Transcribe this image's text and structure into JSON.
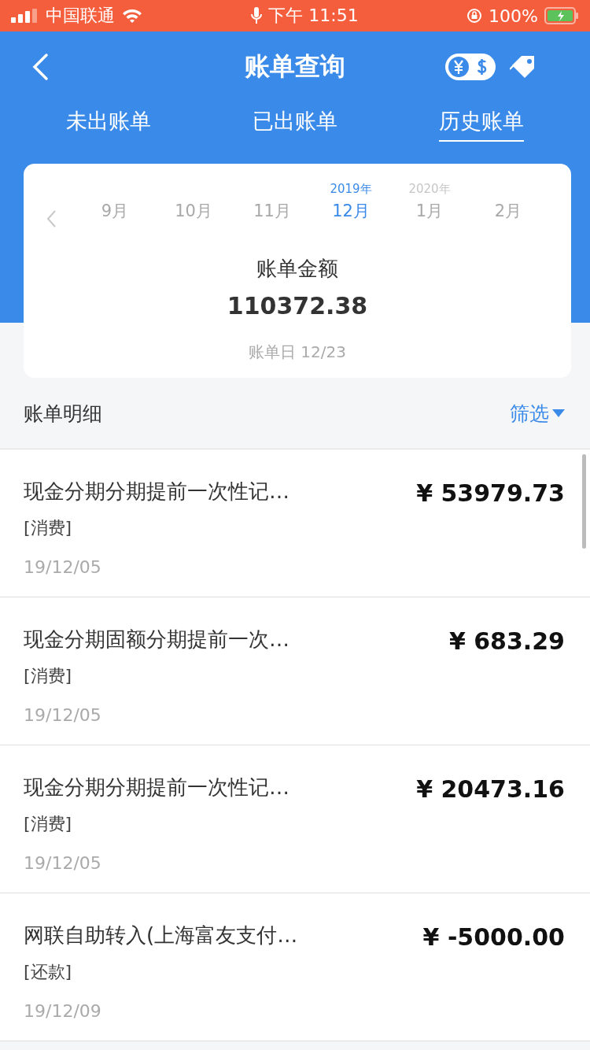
{
  "status_bar": {
    "carrier": "中国联通",
    "time": "下午 11:51",
    "battery": "100%"
  },
  "nav": {
    "title": "账单查询"
  },
  "tabs": [
    {
      "label": "未出账单",
      "selected": false
    },
    {
      "label": "已出账单",
      "selected": false
    },
    {
      "label": "历史账单",
      "selected": true
    }
  ],
  "months": [
    {
      "month": "9月",
      "selected": false
    },
    {
      "month": "10月",
      "selected": false
    },
    {
      "month": "11月",
      "selected": false
    },
    {
      "year": "2019年",
      "month": "12月",
      "selected": true
    },
    {
      "year": "2020年",
      "month": "1月",
      "selected": false
    },
    {
      "month": "2月",
      "selected": false
    }
  ],
  "summary": {
    "label": "账单金额",
    "amount": "110372.38",
    "bill_date": "账单日 12/23"
  },
  "details": {
    "title": "账单明细",
    "filter": "筛选"
  },
  "transactions": [
    {
      "title": "现金分期分期提前一次性记…",
      "category": "[消费]",
      "date": "19/12/05",
      "amount": "¥ 53979.73"
    },
    {
      "title": "现金分期固额分期提前一次…",
      "category": "[消费]",
      "date": "19/12/05",
      "amount": "¥ 683.29"
    },
    {
      "title": "现金分期分期提前一次性记…",
      "category": "[消费]",
      "date": "19/12/05",
      "amount": "¥ 20473.16"
    },
    {
      "title": "网联自助转入(上海富友支付…",
      "category": "[还款]",
      "date": "19/12/09",
      "amount": "¥ -5000.00"
    }
  ]
}
